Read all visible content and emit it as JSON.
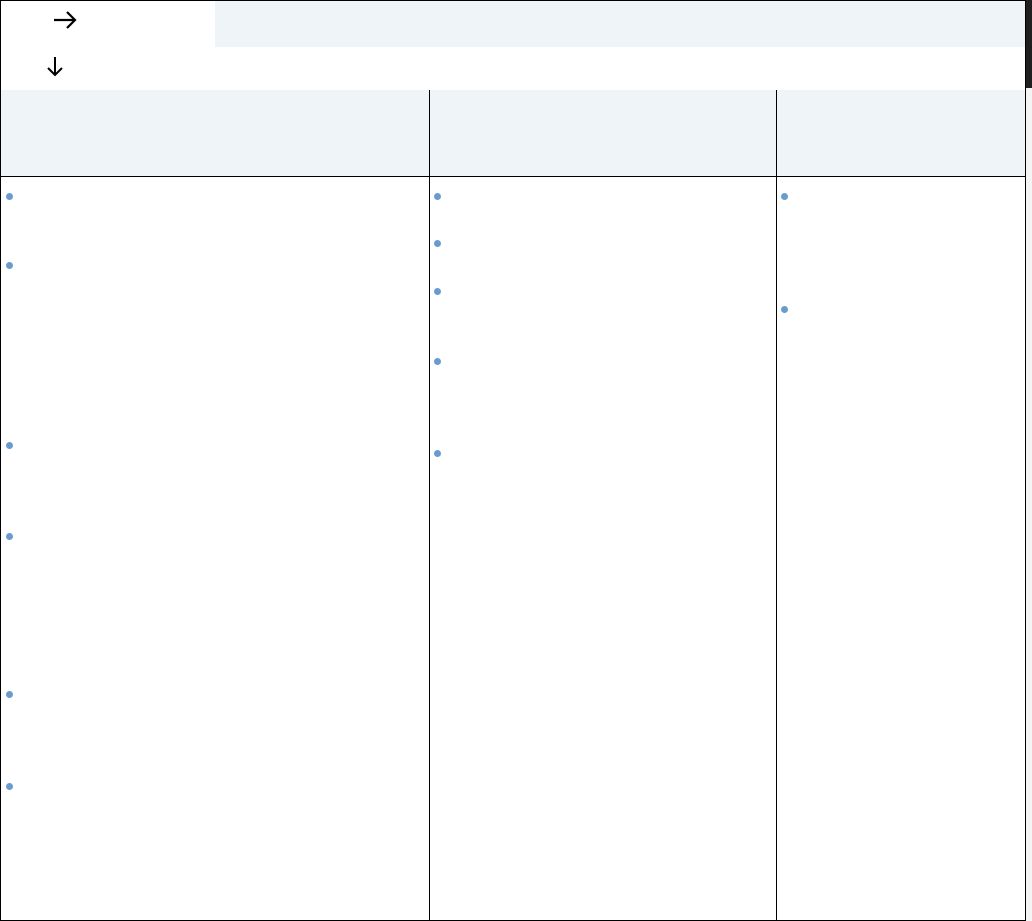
{
  "icons": {
    "forward": "arrow-right-icon",
    "down": "arrow-down-icon",
    "bullet_color": "#6a9bcf",
    "header_fill": "#eff4f9"
  },
  "columns": [
    {
      "bullet_count": 6
    },
    {
      "bullet_count": 5
    },
    {
      "bullet_count": 2
    }
  ]
}
